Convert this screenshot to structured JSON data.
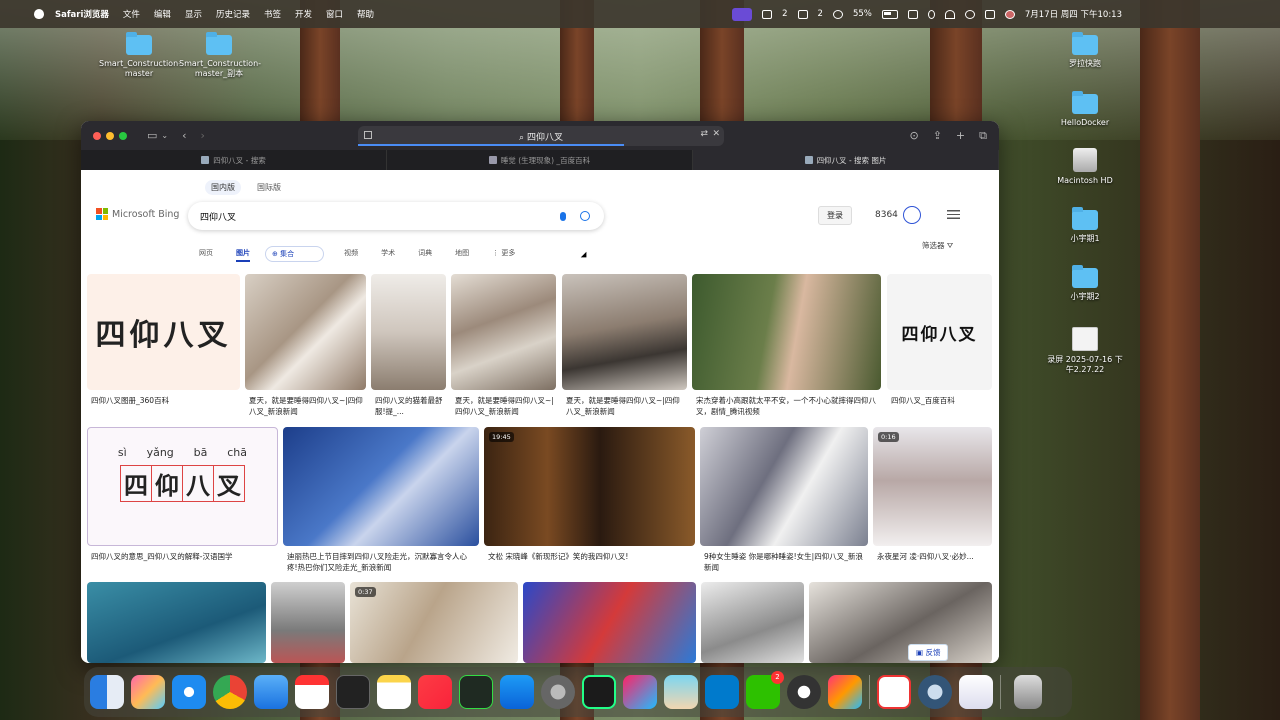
{
  "menubar": {
    "app": "Safari浏览器",
    "items": [
      "文件",
      "编辑",
      "显示",
      "历史记录",
      "书签",
      "开发",
      "窗口",
      "帮助"
    ],
    "wechat_count": "2",
    "group_count": "2",
    "battery": "55%",
    "datetime": "7月17日 周四 下午10:13"
  },
  "desktop": {
    "left_icons": [
      "Smart_Construction-master",
      "Smart_Construction-master_副本"
    ],
    "right_icons": [
      "罗拉快跑",
      "HelloDocker",
      "Macintosh HD",
      "小宇期1",
      "小宇期2",
      "录屏 2025-07-16 下午2.27.22"
    ]
  },
  "browser": {
    "address": "四仰八叉",
    "tabs": [
      {
        "label": "四仰八叉 - 搜索",
        "active": false
      },
      {
        "label": "睡觉 (生理现象) _百度百科",
        "active": false
      },
      {
        "label": "四仰八叉 - 搜索 图片",
        "active": true
      }
    ]
  },
  "bing": {
    "scope": [
      "国内版",
      "国际版"
    ],
    "logo": "Microsoft Bing",
    "query": "四仰八叉",
    "login": "登录",
    "points": "8364",
    "nav": [
      "网页",
      "图片",
      "集合",
      "视频",
      "学术",
      "词典",
      "地图",
      "⋮ 更多"
    ],
    "filter": "筛选器",
    "feedback": "反馈"
  },
  "results": {
    "row1": [
      {
        "caption": "四仰八叉图册_360百科",
        "img_text": "四仰八叉"
      },
      {
        "caption": "夏天，就是要睡得四仰八叉~|四仰八叉_新浪新闻"
      },
      {
        "caption": "四仰八叉的猫着最舒服!提_..."
      },
      {
        "caption": "夏天，就是要睡得四仰八叉~|四仰八叉_新浪新闻"
      },
      {
        "caption": "夏天，就是要睡得四仰八叉~|四仰八叉_新浪新闻"
      },
      {
        "caption": "宋杰穿着小高跟就太平不安，一个不小心就摔得四仰八叉，剧情_腾讯视频"
      },
      {
        "caption": "四仰八叉_百度百科",
        "img_text": "四仰八叉"
      }
    ],
    "row2": [
      {
        "caption": "四仰八叉的意思_四仰八叉的解释-汉语国学",
        "pinyin": [
          "sì",
          "yǎng",
          "bā",
          "chā"
        ],
        "chars": [
          "四",
          "仰",
          "八",
          "叉"
        ]
      },
      {
        "caption": "迪丽热巴上节目摔到四仰八叉险走光，沉默寡言令人心疼!热巴你们又险走光_新浪新闻"
      },
      {
        "caption": "文松 宋晓峰《新现形记》笑的我四仰八叉!",
        "duration": "19:45"
      },
      {
        "caption": "9种女生睡姿 你是哪种睡姿!女生|四仰八叉_新浪新闻"
      },
      {
        "caption": "永夜星河 凌·四仰八叉·必妙...",
        "duration": "0:16"
      }
    ],
    "row3": [
      {
        "duration": "0:37"
      }
    ]
  },
  "colors": {
    "accent": "#1a3fb8",
    "menubar_bg": "#3c362c",
    "toolbar_bg": "#2b2a2f"
  }
}
